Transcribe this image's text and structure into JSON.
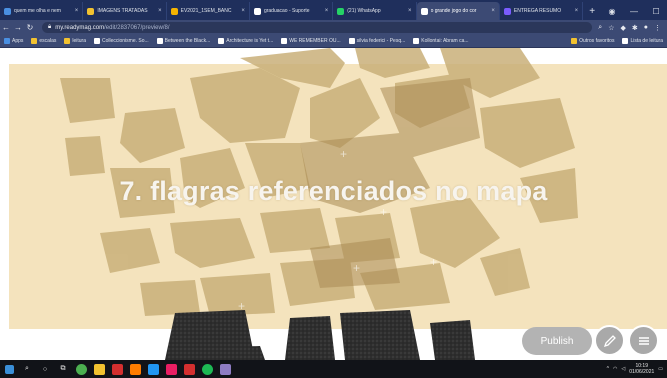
{
  "tabs": [
    {
      "label": "quem me olha e nem",
      "color": "#4a90e2",
      "active": false
    },
    {
      "label": "IMAGENS TRATADAS",
      "color": "#f2c230",
      "active": false
    },
    {
      "label": "EV2021_1SEM_BANC",
      "color": "#f5b400",
      "active": false
    },
    {
      "label": "graduacao - Suporte",
      "color": "#ffffff",
      "active": false
    },
    {
      "label": "(21) WhatsApp",
      "color": "#25d366",
      "active": false
    },
    {
      "label": "o grande jogo do cor",
      "color": "#ffffff",
      "active": true
    },
    {
      "label": "ENTREGA RESUMO",
      "color": "#7a5cff",
      "active": false
    }
  ],
  "address": {
    "host": "my.readymag.com",
    "path": "/edit/2837067/preview/8/"
  },
  "bookmarks": [
    {
      "label": "Apps",
      "color": "#4a90e2"
    },
    {
      "label": "escalas",
      "color": "#f2c230"
    },
    {
      "label": "leitura",
      "color": "#f2c230"
    },
    {
      "label": "Colleccionisme. So...",
      "color": "#ffffff"
    },
    {
      "label": "Between the Black...",
      "color": "#ffffff"
    },
    {
      "label": "Architecture is Yet t...",
      "color": "#ffffff"
    },
    {
      "label": "WE REMEMBER OU...",
      "color": "#ffffff"
    },
    {
      "label": "silvia federici - Pesq...",
      "color": "#ffffff"
    },
    {
      "label": "Kollontai: Abram ca...",
      "color": "#ffffff"
    }
  ],
  "bookmarks_right": [
    {
      "label": "Outros favoritos",
      "color": "#f2c230"
    },
    {
      "label": "Lista de leitura",
      "color": "#ffffff"
    }
  ],
  "headline": "7. flagras referenciados no mapa",
  "buttons": {
    "publish": "Publish"
  },
  "taskbar": {
    "time": "10:19",
    "date": "01/06/2021"
  },
  "colors": {
    "panel": "#f4e3bd",
    "map_block": "#c9b07a",
    "map_dark": "#2b2b2b",
    "tab_strip": "#1f2f5c"
  }
}
